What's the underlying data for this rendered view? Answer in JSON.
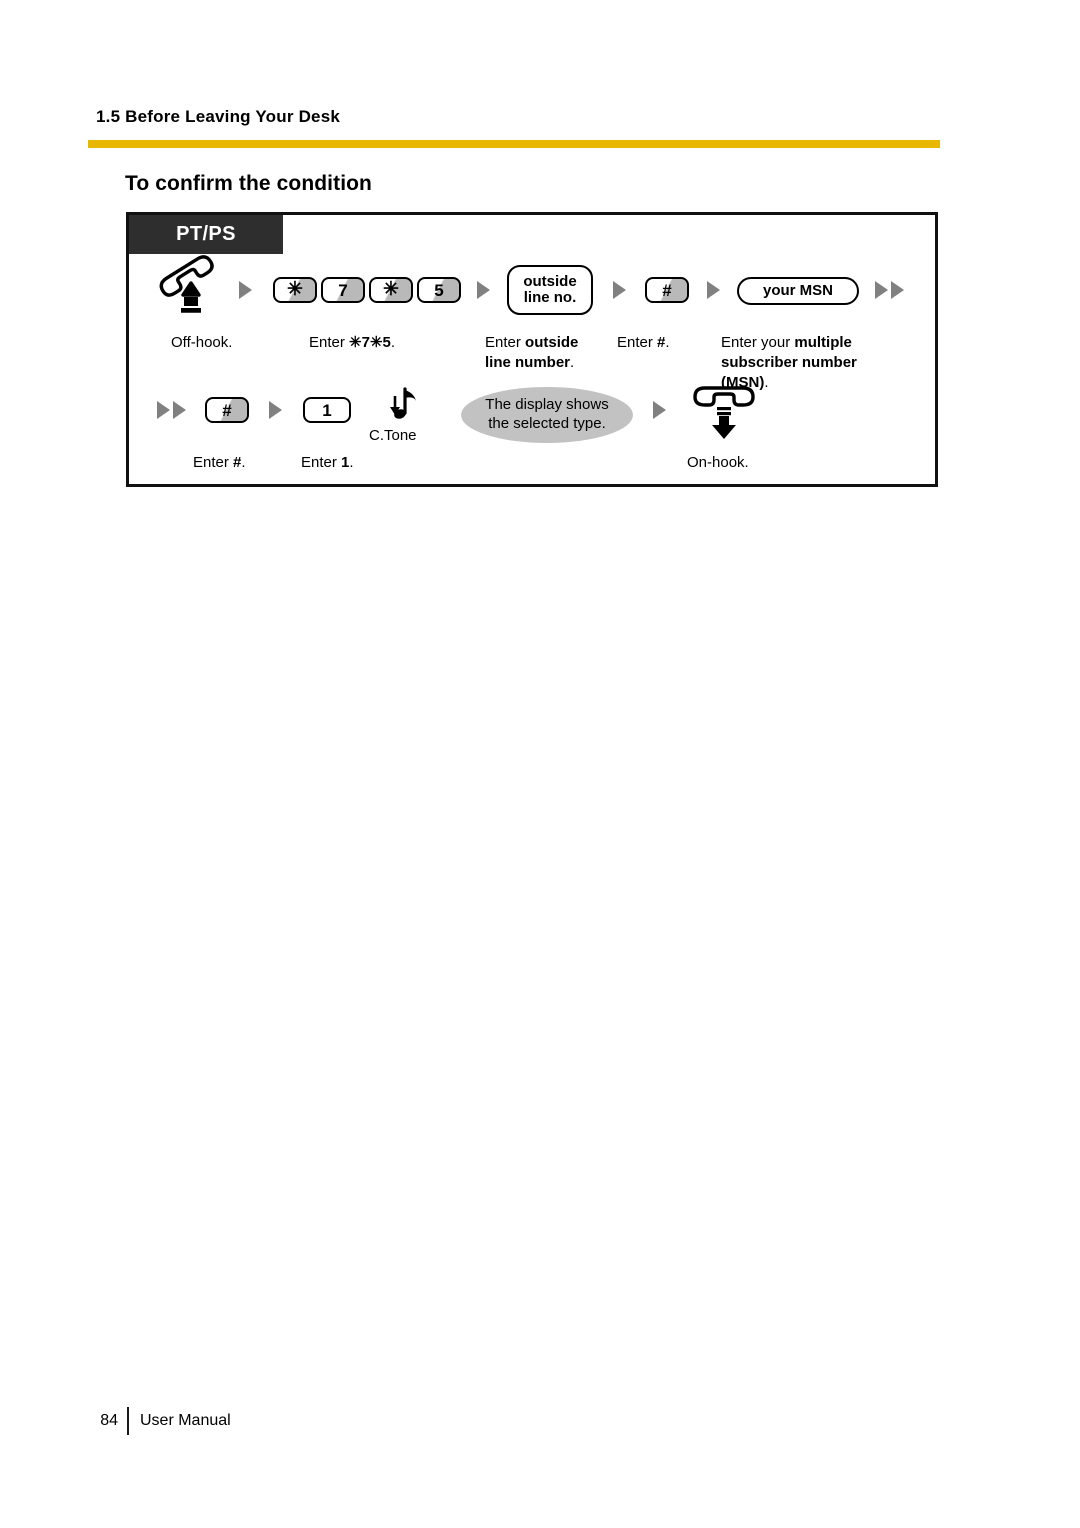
{
  "page": {
    "running_head": "1.5 Before Leaving Your Desk",
    "section_heading": "To confirm the condition",
    "rule_color": "#e8b800"
  },
  "footer": {
    "page_number": "84",
    "label": "User Manual"
  },
  "diagram": {
    "phone_type_tag": "PT/PS",
    "row1": {
      "steps": [
        {
          "kind": "icon",
          "icon": "off-hook-handset-icon",
          "caption_plain": "Off-hook."
        },
        {
          "kind": "keys",
          "keys": [
            "✳",
            "7",
            "✳",
            "5"
          ],
          "caption_prefix": "Enter ",
          "caption_bold": "✳7✳5",
          "caption_suffix": "."
        },
        {
          "kind": "pill",
          "pill_lines": [
            "outside",
            "line no."
          ],
          "caption_prefix": "Enter ",
          "caption_bold": "outside line number",
          "caption_suffix": "."
        },
        {
          "kind": "key",
          "key": "#",
          "caption_prefix": "Enter ",
          "caption_bold": "#",
          "caption_suffix": "."
        },
        {
          "kind": "pill",
          "pill_lines": [
            "your MSN"
          ],
          "caption_prefix": "Enter your ",
          "caption_bold": "multiple subscriber number (MSN)",
          "caption_suffix": "."
        }
      ]
    },
    "row2": {
      "steps": [
        {
          "kind": "key",
          "key": "#",
          "caption_prefix": "Enter ",
          "caption_bold": "#",
          "caption_suffix": "."
        },
        {
          "kind": "key_plain",
          "key": "1",
          "caption_prefix": "Enter ",
          "caption_bold": "1",
          "caption_suffix": "."
        },
        {
          "kind": "tone",
          "icon": "confirmation-tone-icon",
          "label": "C.Tone"
        },
        {
          "kind": "callout",
          "lines": [
            "The display shows",
            "the selected type."
          ]
        },
        {
          "kind": "icon",
          "icon": "on-hook-handset-icon",
          "caption_plain": "On-hook."
        }
      ]
    },
    "captions": {
      "off_hook": "Off-hook.",
      "enter_code_prefix": "Enter ",
      "enter_code_bold": "✳7✳5",
      "enter_code_suffix": ".",
      "enter_outside_prefix": "Enter ",
      "enter_outside_bold_1": "outside",
      "enter_outside_bold_2": "line number",
      "enter_outside_suffix": ".",
      "enter_hash_prefix": "Enter ",
      "enter_hash_bold": "#",
      "enter_hash_suffix": ".",
      "enter_msn_prefix": "Enter your ",
      "enter_msn_bold_1": "multiple",
      "enter_msn_bold_2": "subscriber number",
      "enter_msn_bold_3": "(MSN)",
      "enter_msn_suffix": ".",
      "enter_hash2_prefix": "Enter ",
      "enter_hash2_bold": "#",
      "enter_hash2_suffix": ".",
      "enter_one_prefix": "Enter ",
      "enter_one_bold": "1",
      "enter_one_suffix": ".",
      "c_tone": "C.Tone",
      "callout_line1": "The display shows",
      "callout_line2": "the selected type.",
      "on_hook": "On-hook."
    },
    "keys": {
      "star": "✳",
      "seven": "7",
      "star2": "✳",
      "five": "5",
      "hash1": "#",
      "hash2": "#",
      "one": "1"
    },
    "pills": {
      "outside_line_1": "outside",
      "outside_line_2": "line no.",
      "your_msn": "your MSN"
    },
    "colors": {
      "tag_background": "#2e2e2e",
      "arrow": "#808080",
      "key_shade": "#b9b9b9",
      "callout": "#c2c2c2",
      "frame": "#111111"
    }
  }
}
